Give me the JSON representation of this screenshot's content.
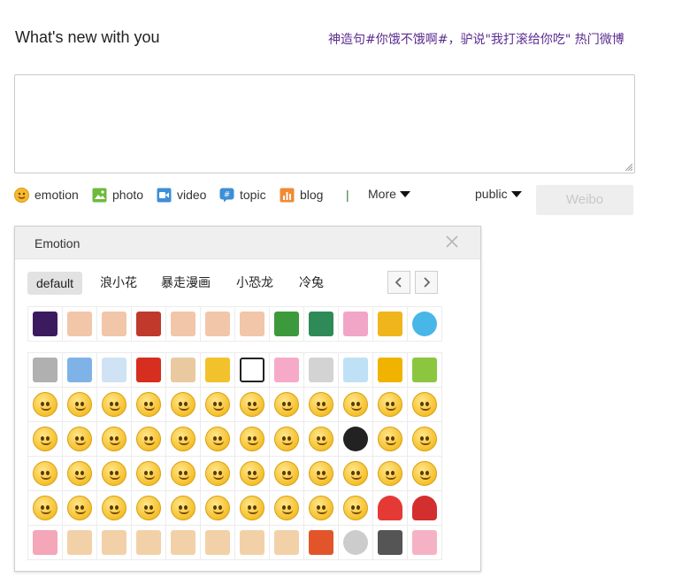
{
  "header": {
    "title": "What's new with you",
    "hot_topic": "神造句#你饿不饿啊#，驴说\"我打滚给你吃\" 热门微博"
  },
  "toolbar": {
    "emotion": "emotion",
    "photo": "photo",
    "video": "video",
    "topic": "topic",
    "blog": "blog",
    "separator": "|",
    "more": "More",
    "visibility": "public",
    "submit": "Weibo"
  },
  "emotion_panel": {
    "title": "Emotion",
    "tabs": [
      "default",
      "浪小花",
      "暴走漫画",
      "小恐龙",
      "冷兔"
    ],
    "active_tab": "default",
    "row1": [
      "night-sky",
      "rage-face",
      "rage-face",
      "horse-card",
      "rage-face",
      "rage-face",
      "rage-face",
      "green-can",
      "green-dino",
      "pink-bunny",
      "yellow-pet",
      "globe"
    ],
    "grid": [
      [
        "sloth",
        "grid-box",
        "cloud",
        "red-card",
        "figure",
        "arrow-down",
        "panda",
        "pink-pig",
        "robot",
        "bell-house",
        "money-face",
        "gift"
      ],
      [
        "smile",
        "grin",
        "laugh",
        "blush",
        "shy",
        "sweat",
        "cry-laugh",
        "tongue",
        "cute",
        "think",
        "angry",
        "pout"
      ],
      [
        "sob",
        "yawn",
        "surprise",
        "sleepy",
        "embarrass",
        "wide-eyes",
        "sulk",
        "dizzy",
        "meh",
        "dark-face",
        "frown",
        "amazed"
      ],
      [
        "hide",
        "cover",
        "rage",
        "happy",
        "crazy",
        "chin",
        "shock",
        "sly",
        "yawn2",
        "tired",
        "money",
        "sad"
      ],
      [
        "sunglasses",
        "heart-eyes",
        "grumpy",
        "pray",
        "spiral",
        "bored",
        "scream",
        "smirk",
        "giggle",
        "mad",
        "heart",
        "broken-heart"
      ],
      [
        "pig",
        "ok-hand",
        "victory",
        "thumbs-up",
        "point",
        "thumb",
        "hand-wave",
        "thumbs-down",
        "candle",
        "clock",
        "microphone",
        "cake"
      ]
    ]
  }
}
